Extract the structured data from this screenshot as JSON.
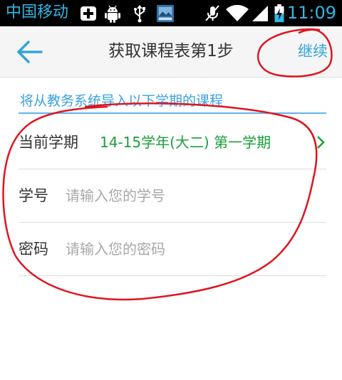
{
  "status_bar": {
    "carrier": "中国移动",
    "time": "11:09"
  },
  "header": {
    "title": "获取课程表第1步",
    "continue_label": "继续"
  },
  "form": {
    "hint": "将从教务系统导入以下学期的课程",
    "semester": {
      "label": "当前学期",
      "value": "14-15学年(大二) 第一学期"
    },
    "student_id": {
      "label": "学号",
      "value": "",
      "placeholder": "请输入您的学号"
    },
    "password": {
      "label": "密码",
      "value": "",
      "placeholder": "请输入您的密码"
    }
  },
  "colors": {
    "accent": "#33a3dc",
    "semester_green": "#1aa03a",
    "annotation_red": "#e0141e"
  },
  "icons": [
    "plus-box-icon",
    "android-icon",
    "usb-icon",
    "image-icon",
    "mute-icon",
    "wifi-icon",
    "signal-icon",
    "battery-charging-icon",
    "back-arrow-icon",
    "chevron-right-icon"
  ]
}
